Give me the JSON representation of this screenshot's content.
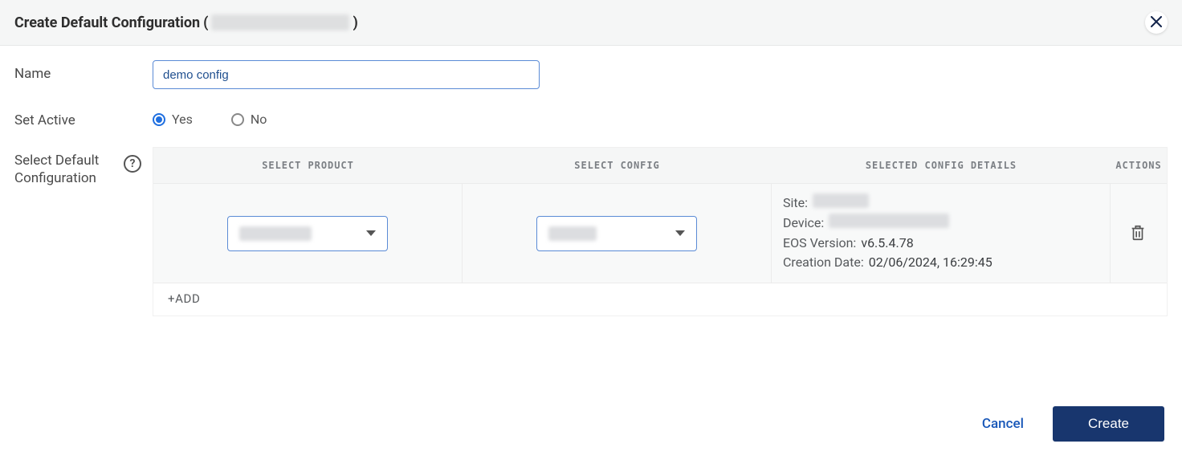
{
  "header": {
    "title": "Create Default Configuration",
    "open_paren": "(",
    "close_paren": ")"
  },
  "form": {
    "name_label": "Name",
    "name_value": "demo config",
    "set_active_label": "Set Active",
    "radio_yes": "Yes",
    "radio_no": "No",
    "select_default_config_label": "Select Default Configuration"
  },
  "table": {
    "headers": {
      "product": "SELECT PRODUCT",
      "config": "SELECT CONFIG",
      "details": "SELECTED CONFIG DETAILS",
      "actions": "ACTIONS"
    },
    "row": {
      "site_label": "Site:",
      "device_label": "Device:",
      "eos_label": "EOS Version:",
      "eos_value": "v6.5.4.78",
      "creation_label": "Creation Date:",
      "creation_value": "02/06/2024, 16:29:45"
    },
    "add_label": "+ADD"
  },
  "footer": {
    "cancel": "Cancel",
    "create": "Create"
  }
}
